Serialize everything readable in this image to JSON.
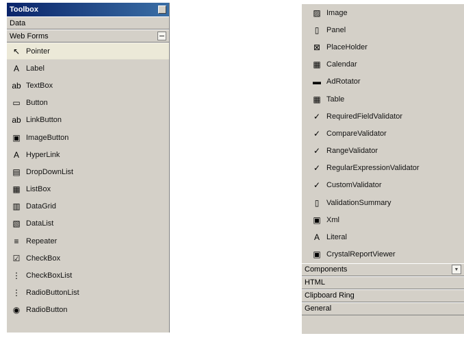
{
  "toolbox": {
    "title": "Toolbox",
    "data_section": "Data",
    "web_forms_section": "Web Forms",
    "items": [
      {
        "label": "Pointer",
        "icon": "pointer-icon",
        "glyph": "↖"
      },
      {
        "label": "Label",
        "icon": "label-icon",
        "glyph": "A"
      },
      {
        "label": "TextBox",
        "icon": "textbox-icon",
        "glyph": "ab"
      },
      {
        "label": "Button",
        "icon": "button-icon",
        "glyph": "▭"
      },
      {
        "label": "LinkButton",
        "icon": "linkbutton-icon",
        "glyph": "ab"
      },
      {
        "label": "ImageButton",
        "icon": "imagebutton-icon",
        "glyph": "▣"
      },
      {
        "label": "HyperLink",
        "icon": "hyperlink-icon",
        "glyph": "A"
      },
      {
        "label": "DropDownList",
        "icon": "dropdownlist-icon",
        "glyph": "▤"
      },
      {
        "label": "ListBox",
        "icon": "listbox-icon",
        "glyph": "▦"
      },
      {
        "label": "DataGrid",
        "icon": "datagrid-icon",
        "glyph": "▥"
      },
      {
        "label": "DataList",
        "icon": "datalist-icon",
        "glyph": "▧"
      },
      {
        "label": "Repeater",
        "icon": "repeater-icon",
        "glyph": "≡"
      },
      {
        "label": "CheckBox",
        "icon": "checkbox-icon",
        "glyph": "☑"
      },
      {
        "label": "CheckBoxList",
        "icon": "checkboxlist-icon",
        "glyph": "⋮"
      },
      {
        "label": "RadioButtonList",
        "icon": "radiobuttonlist-icon",
        "glyph": "⋮"
      },
      {
        "label": "RadioButton",
        "icon": "radiobutton-icon",
        "glyph": "◉"
      }
    ]
  },
  "toolbox_right": {
    "items": [
      {
        "label": "Image",
        "icon": "image-icon",
        "glyph": "▨"
      },
      {
        "label": "Panel",
        "icon": "panel-icon",
        "glyph": "▯"
      },
      {
        "label": "PlaceHolder",
        "icon": "placeholder-icon",
        "glyph": "⊠"
      },
      {
        "label": "Calendar",
        "icon": "calendar-icon",
        "glyph": "▦"
      },
      {
        "label": "AdRotator",
        "icon": "adrotator-icon",
        "glyph": "▬"
      },
      {
        "label": "Table",
        "icon": "table-icon",
        "glyph": "▦"
      },
      {
        "label": "RequiredFieldValidator",
        "icon": "requiredfieldvalidator-icon",
        "glyph": "✓"
      },
      {
        "label": "CompareValidator",
        "icon": "comparevalidator-icon",
        "glyph": "✓"
      },
      {
        "label": "RangeValidator",
        "icon": "rangevalidator-icon",
        "glyph": "✓"
      },
      {
        "label": "RegularExpressionValidator",
        "icon": "regularexpressionvalidator-icon",
        "glyph": "✓"
      },
      {
        "label": "CustomValidator",
        "icon": "customvalidator-icon",
        "glyph": "✓"
      },
      {
        "label": "ValidationSummary",
        "icon": "validationsummary-icon",
        "glyph": "▯"
      },
      {
        "label": "Xml",
        "icon": "xml-icon",
        "glyph": "▣"
      },
      {
        "label": "Literal",
        "icon": "literal-icon",
        "glyph": "A"
      },
      {
        "label": "CrystalReportViewer",
        "icon": "crystalreportviewer-icon",
        "glyph": "▣"
      }
    ],
    "components_section": "Components",
    "html_section": "HTML",
    "clipboard_ring_section": "Clipboard Ring",
    "general_section": "General"
  }
}
